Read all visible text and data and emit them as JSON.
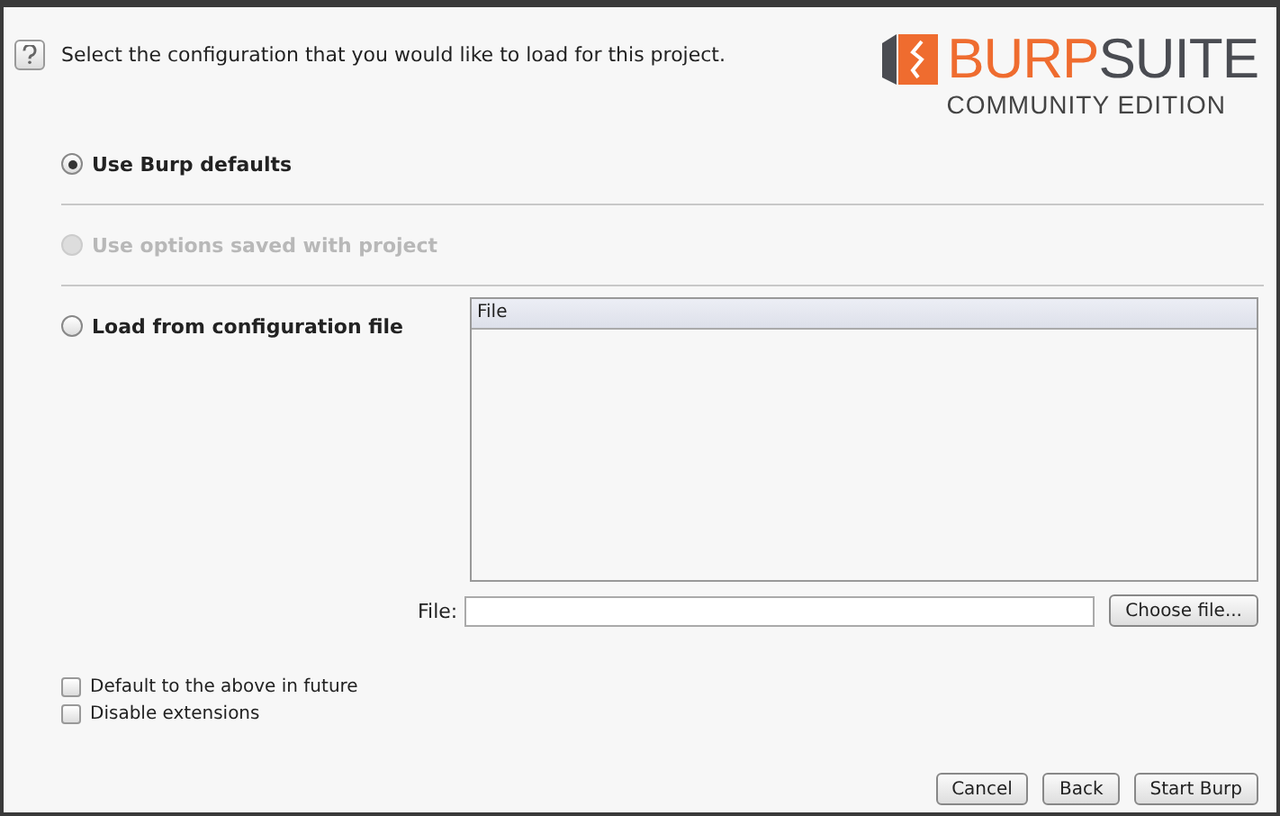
{
  "prompt": "Select the configuration that you would like to load for this project.",
  "logo": {
    "brand_left": "BURP",
    "brand_right": "SUITE",
    "edition": "COMMUNITY EDITION"
  },
  "options": [
    {
      "label": "Use Burp defaults",
      "selected": true,
      "disabled": false
    },
    {
      "label": "Use options saved with project",
      "selected": false,
      "disabled": true
    },
    {
      "label": "Load from configuration file",
      "selected": false,
      "disabled": false
    }
  ],
  "file_table": {
    "columns": [
      "File"
    ]
  },
  "file_field": {
    "label": "File:",
    "button": "Choose file..."
  },
  "checkboxes": [
    {
      "label": "Default to the above in future",
      "checked": false
    },
    {
      "label": "Disable extensions",
      "checked": false
    }
  ],
  "buttons": [
    "Cancel",
    "Back",
    "Start Burp"
  ]
}
